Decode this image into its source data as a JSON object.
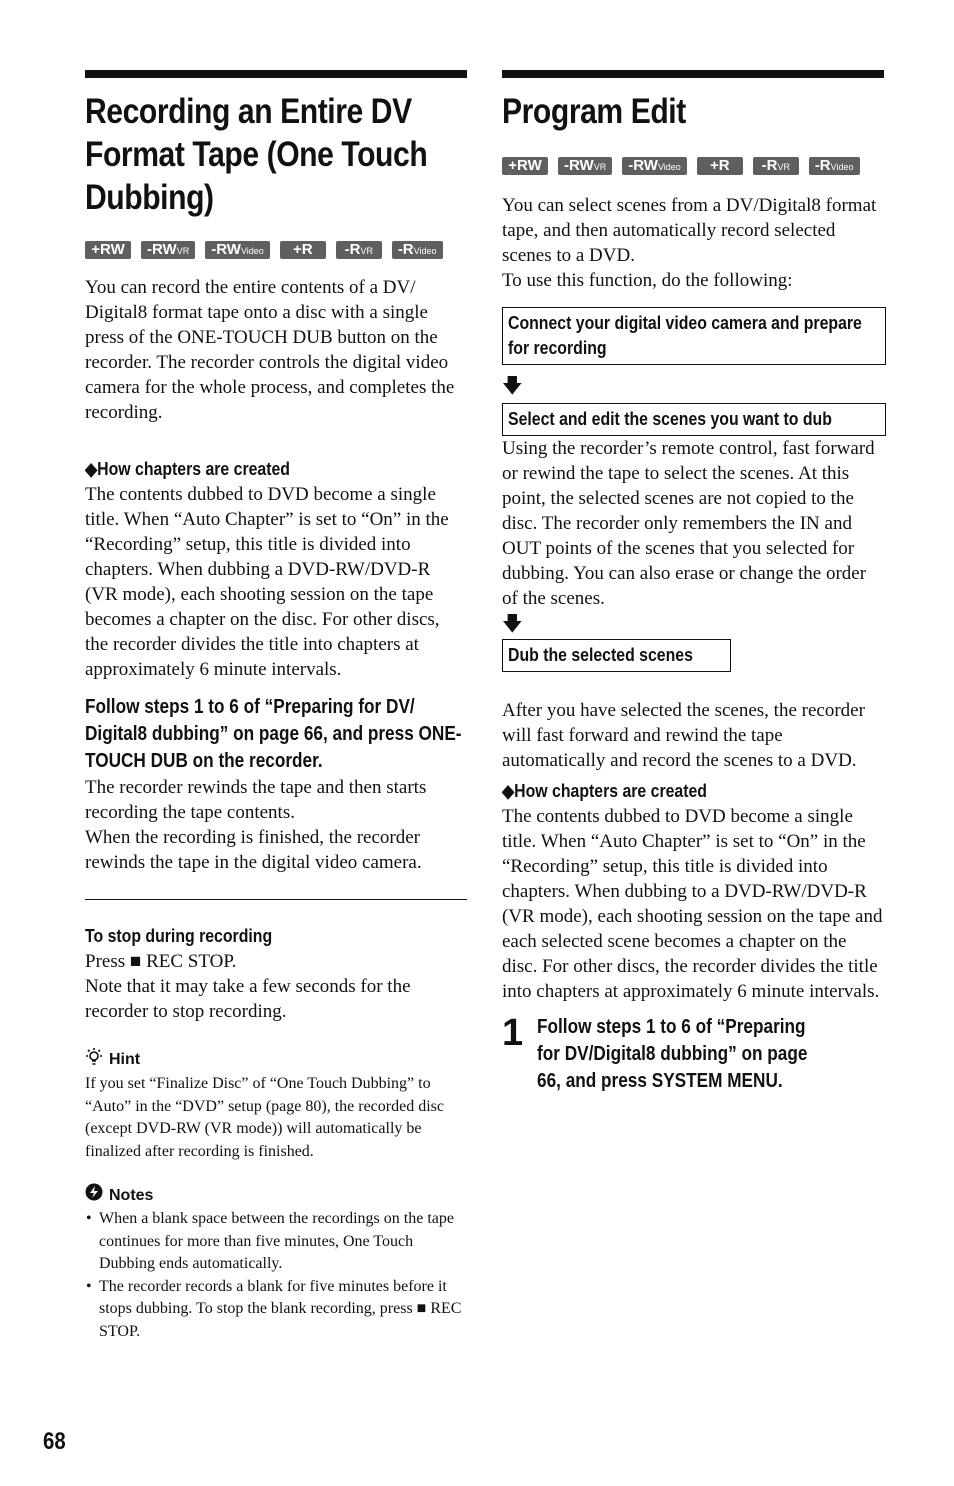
{
  "disc_badges": [
    {
      "main": "+RW",
      "sub": ""
    },
    {
      "main": "-RW",
      "sub": "VR"
    },
    {
      "main": "-RW",
      "sub": "Video"
    },
    {
      "main": "+R",
      "sub": ""
    },
    {
      "main": "-R",
      "sub": "VR"
    },
    {
      "main": "-R",
      "sub": "Video"
    }
  ],
  "left": {
    "title": "Recording an Entire DV Format Tape (One Touch Dubbing)",
    "intro": "You can record the entire contents of a DV/ Digital8 format tape onto a disc with a single press of the ONE-TOUCH DUB button on the recorder. The recorder controls the digital video camera for the whole process, and completes the recording.",
    "chapters_heading": "◆How chapters are created",
    "chapters_text": "The contents dubbed to DVD become a single title. When “Auto Chapter” is set to “On” in the “Recording” setup, this title is divided into chapters. When dubbing a DVD-RW/DVD-R (VR mode), each shooting session on the tape becomes a chapter on the disc. For other discs, the recorder divides the title into chapters at approximately 6 minute intervals.",
    "step_heading": "Follow steps 1 to 6 of “Preparing for DV/ Digital8 dubbing” on page 66, and press ONE-TOUCH DUB on the recorder.",
    "step_text1": "The recorder rewinds the tape and then starts recording the tape contents.",
    "step_text2": "When the recording is finished, the recorder rewinds the tape in the digital video camera.",
    "stop_heading": "To stop during recording",
    "stop_text1": "Press ■ REC STOP.",
    "stop_text2": "Note that it may take a few seconds for the recorder to stop recording.",
    "hint_label": "Hint",
    "hint_text": "If you set “Finalize Disc” of “One Touch Dubbing” to “Auto” in the “DVD” setup (page 80), the recorded disc (except DVD-RW (VR mode)) will automatically be finalized after recording is finished.",
    "notes_label": "Notes",
    "notes": [
      "When a blank space between the recordings on the tape continues for more than five minutes, One Touch Dubbing ends automatically.",
      "The recorder records a blank for five minutes before it stops dubbing. To stop the blank recording, press ■ REC STOP."
    ]
  },
  "right": {
    "title": "Program Edit",
    "intro1": "You can select scenes from a DV/Digital8 format tape, and then automatically record selected scenes to a DVD.",
    "intro2": "To use this function, do the following:",
    "flow_box1": "Connect your digital video camera and prepare for recording",
    "flow_box2": "Select and edit the scenes you want to dub",
    "flow_box2_text": "Using the recorder’s remote control, fast forward or rewind the tape to select the scenes. At this point, the selected scenes are not copied to the disc. The recorder only remembers the IN and OUT points of the scenes that you selected for dubbing. You can also erase or change the order of the scenes.",
    "flow_box3": "Dub the selected scenes",
    "after_text": "After you have selected the scenes, the recorder will fast forward and rewind the tape automatically and record the scenes to a DVD.",
    "chapters_heading": "◆How chapters are created",
    "chapters_text": "The contents dubbed to DVD become a single title. When “Auto Chapter” is set to “On” in the “Recording” setup, this title is divided into chapters. When dubbing to a DVD-RW/DVD-R (VR mode), each shooting session on the tape and each selected scene becomes a chapter on the disc. For other discs, the recorder divides the title into chapters at approximately 6 minute intervals.",
    "step_number": "1",
    "step_text": "Follow steps 1 to 6 of “Preparing for DV/Digital8 dubbing” on page 66, and press SYSTEM MENU."
  },
  "page_number": "68"
}
